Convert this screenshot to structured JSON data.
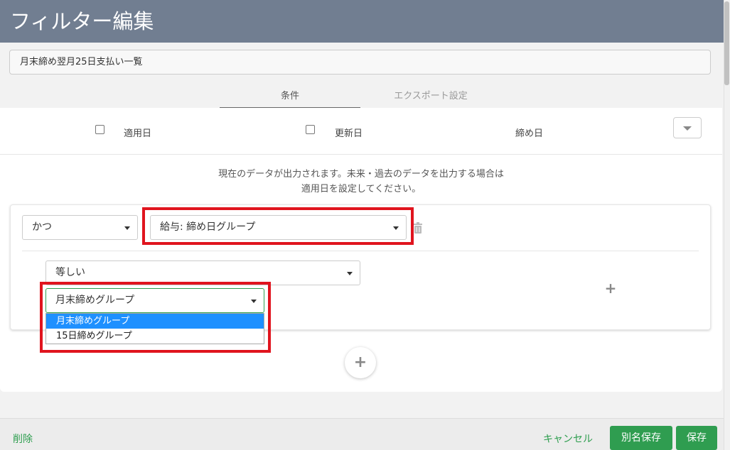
{
  "header": {
    "title": "フィルター編集"
  },
  "filter_name": {
    "value": "月末締め翌月25日支払い一覧"
  },
  "tabs": [
    {
      "label": "条件",
      "active": true
    },
    {
      "label": "エクスポート設定",
      "active": false
    }
  ],
  "columns": {
    "applied_date_label": "適用日",
    "updated_date_label": "更新日",
    "closing_date_label": "締め日"
  },
  "info": {
    "line1": "現在のデータが出力されます。未来・過去のデータを出力する場合は",
    "line2": "適用日を設定してください。"
  },
  "condition": {
    "logic_value": "かつ",
    "field_value": "給与: 締め日グループ",
    "operator_value": "等しい",
    "target_value": "月末締めグループ",
    "dropdown_options": [
      "月末締めグループ",
      "15日締めグループ"
    ]
  },
  "footer": {
    "delete_label": "削除",
    "cancel_label": "キャンセル",
    "save_as_label": "別名保存",
    "save_label": "保存"
  },
  "colors": {
    "header_bg": "#717e91",
    "accent_green": "#2f9d50",
    "highlight_red": "#e0141e",
    "option_selected": "#1e90ff"
  }
}
